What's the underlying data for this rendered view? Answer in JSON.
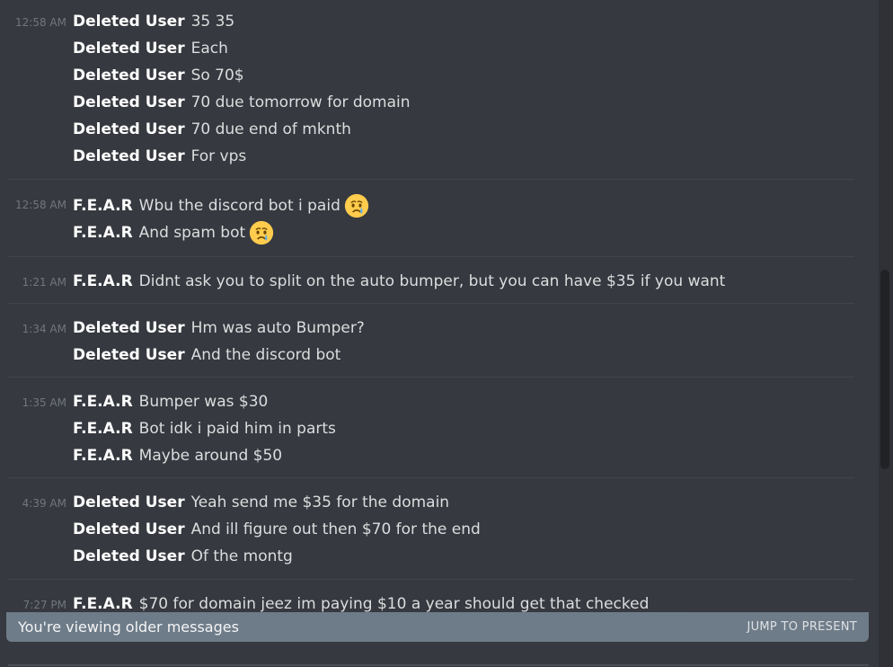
{
  "messages": [
    {
      "time": "12:58 AM",
      "lines": [
        {
          "author": "Deleted User",
          "text": "35 35"
        },
        {
          "author": "Deleted User",
          "text": "Each"
        },
        {
          "author": "Deleted User",
          "text": "So 70$"
        },
        {
          "author": "Deleted User",
          "text": "70 due tomorrow for domain"
        },
        {
          "author": "Deleted User",
          "text": "70 due end of mknth"
        },
        {
          "author": "Deleted User",
          "text": "For vps"
        }
      ]
    },
    {
      "time": "12:58 AM",
      "lines": [
        {
          "author": "F.E.A.R",
          "text": "Wbu the discord bot i paid",
          "emoji": "crying-face-emoji"
        },
        {
          "author": "F.E.A.R",
          "text": "And spam bot",
          "emoji": "crying-face-emoji"
        }
      ]
    },
    {
      "time": "1:21 AM",
      "lines": [
        {
          "author": "F.E.A.R",
          "text": "Didnt ask you to split on the auto bumper, but you can have $35 if you want"
        }
      ]
    },
    {
      "time": "1:34 AM",
      "lines": [
        {
          "author": "Deleted User",
          "text": "Hm was auto Bumper?"
        },
        {
          "author": "Deleted User",
          "text": "And the discord bot"
        }
      ]
    },
    {
      "time": "1:35 AM",
      "lines": [
        {
          "author": "F.E.A.R",
          "text": "Bumper was $30"
        },
        {
          "author": "F.E.A.R",
          "text": "Bot idk i paid him in parts"
        },
        {
          "author": "F.E.A.R",
          "text": "Maybe around $50"
        }
      ]
    },
    {
      "time": "4:39 AM",
      "lines": [
        {
          "author": "Deleted User",
          "text": "Yeah send me $35 for the domain"
        },
        {
          "author": "Deleted User",
          "text": "And ill figure out then $70 for the end"
        },
        {
          "author": "Deleted User",
          "text": "Of the montg"
        }
      ]
    },
    {
      "time": "7:27 PM",
      "lines": [
        {
          "author": "F.E.A.R",
          "text": "$70 for domain jeez im paying $10 a year should get that checked"
        }
      ]
    }
  ],
  "older_bar": {
    "text": "You're viewing older messages",
    "jump_label": "JUMP TO PRESENT"
  },
  "colors": {
    "background": "#36393f",
    "author": "#ffffff",
    "timestamp": "#72767d",
    "bar": "#72808e"
  }
}
